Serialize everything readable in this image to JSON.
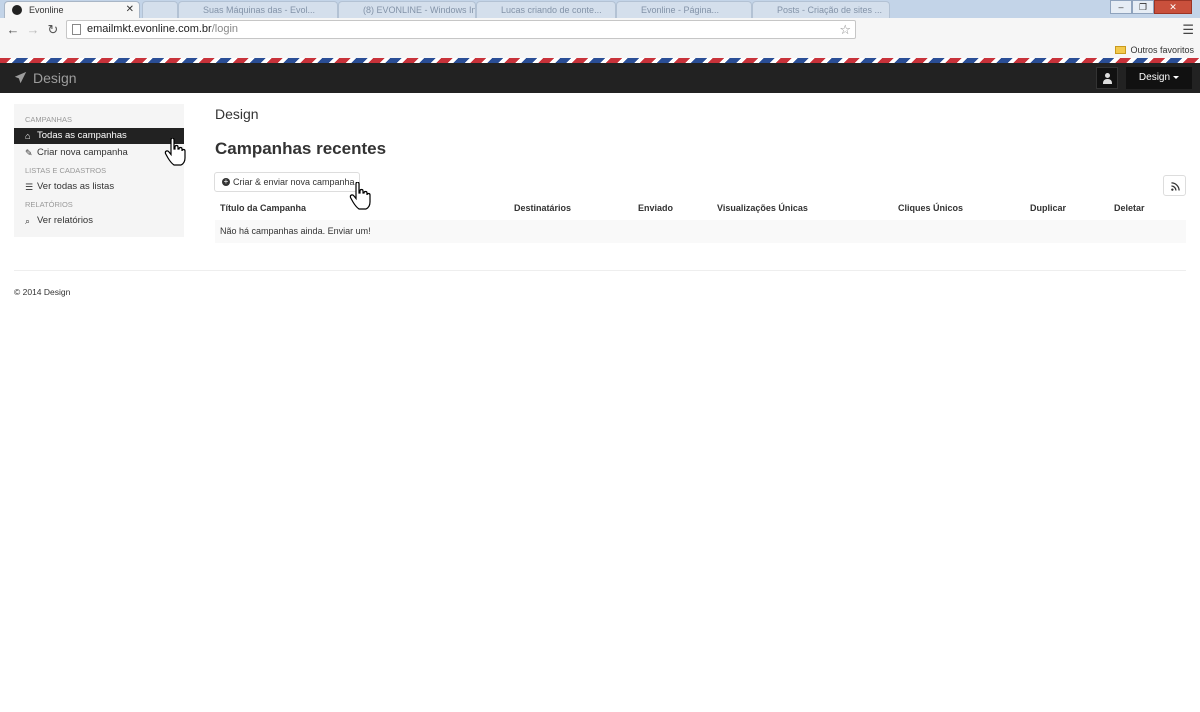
{
  "browser": {
    "active_tab_title": "Evonline",
    "inactive_tabs": [
      "",
      "Suas Máquinas das - Evol...",
      "(8) EVONLINE - Windows Inter...",
      "Lucas criando de conte...",
      "Evonline - Página...",
      "Posts - Criação de sites ..."
    ],
    "url_host": "emailmkt.evonline.com.br",
    "url_path": "/login",
    "bookmark_folder": "Outros favoritos"
  },
  "app": {
    "brand": "Design",
    "user_menu": "Design"
  },
  "sidebar": {
    "sections": [
      {
        "header": "CAMPANHAS",
        "items": [
          "Todas as campanhas",
          "Criar nova campanha"
        ]
      },
      {
        "header": "LISTAS E CADASTROS",
        "items": [
          "Ver todas as listas"
        ]
      },
      {
        "header": "RELATÓRIOS",
        "items": [
          "Ver relatórios"
        ]
      }
    ]
  },
  "main": {
    "heading": "Design",
    "section_title": "Campanhas recentes",
    "create_button": "Criar & enviar nova campanha",
    "table": {
      "columns": [
        "Título da Campanha",
        "Destinatários",
        "Enviado",
        "Visualizações Únicas",
        "Cliques Únicos",
        "Duplicar",
        "Deletar"
      ],
      "empty_message": "Não há campanhas ainda. Enviar um!"
    }
  },
  "footer": {
    "text": "© 2014 Design"
  }
}
